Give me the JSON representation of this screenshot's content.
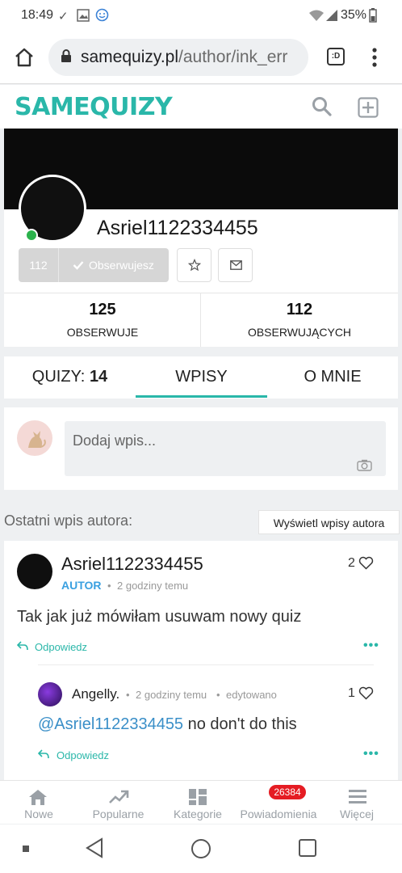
{
  "status_bar": {
    "time": "18:49",
    "battery": "35%"
  },
  "browser": {
    "url_host": "samequizy.pl",
    "url_path": "/author/ink_err",
    "tab_switcher": ":D"
  },
  "site": {
    "logo_same": "SAME",
    "logo_quizy": "QUIZY"
  },
  "profile": {
    "username": "Asriel1122334455",
    "followers_count_button": "112",
    "follow_label": "Obserwujesz",
    "following_count": "125",
    "following_label": "OBSERWUJE",
    "followers_count": "112",
    "followers_label": "OBSERWUJĄCYCH"
  },
  "tabs": [
    {
      "label": "QUIZY:",
      "count": "14"
    },
    {
      "label": "WPISY"
    },
    {
      "label": "O MNIE"
    }
  ],
  "composer": {
    "placeholder": "Dodaj wpis..."
  },
  "last_post": {
    "section_title": "Ostatni wpis autora:",
    "view_button": "Wyświetl wpisy autora",
    "author": "Asriel1122334455",
    "author_badge": "AUTOR",
    "time": "2 godziny temu",
    "likes": "2",
    "text": "Tak jak już mówiłam usuwam nowy quiz",
    "reply_label": "Odpowiedz",
    "comment": {
      "author": "Angelly.",
      "time": "2 godziny temu",
      "edited": "edytowano",
      "likes": "1",
      "mention": "@Asriel1122334455",
      "text": " no don't do this",
      "reply_label": "Odpowiedz"
    }
  },
  "bottom_nav": {
    "items": [
      {
        "label": "Nowe",
        "icon": "home-icon"
      },
      {
        "label": "Popularne",
        "icon": "trending-icon"
      },
      {
        "label": "Kategorie",
        "icon": "grid-icon"
      },
      {
        "label": "Powiadomienia",
        "icon": "bell-icon"
      },
      {
        "label": "Więcej",
        "icon": "menu-icon"
      }
    ],
    "notification_badge": "26384"
  },
  "colors": {
    "brand": "#2ab7a9",
    "badge": "#e51c23",
    "online": "#2bb24c"
  }
}
